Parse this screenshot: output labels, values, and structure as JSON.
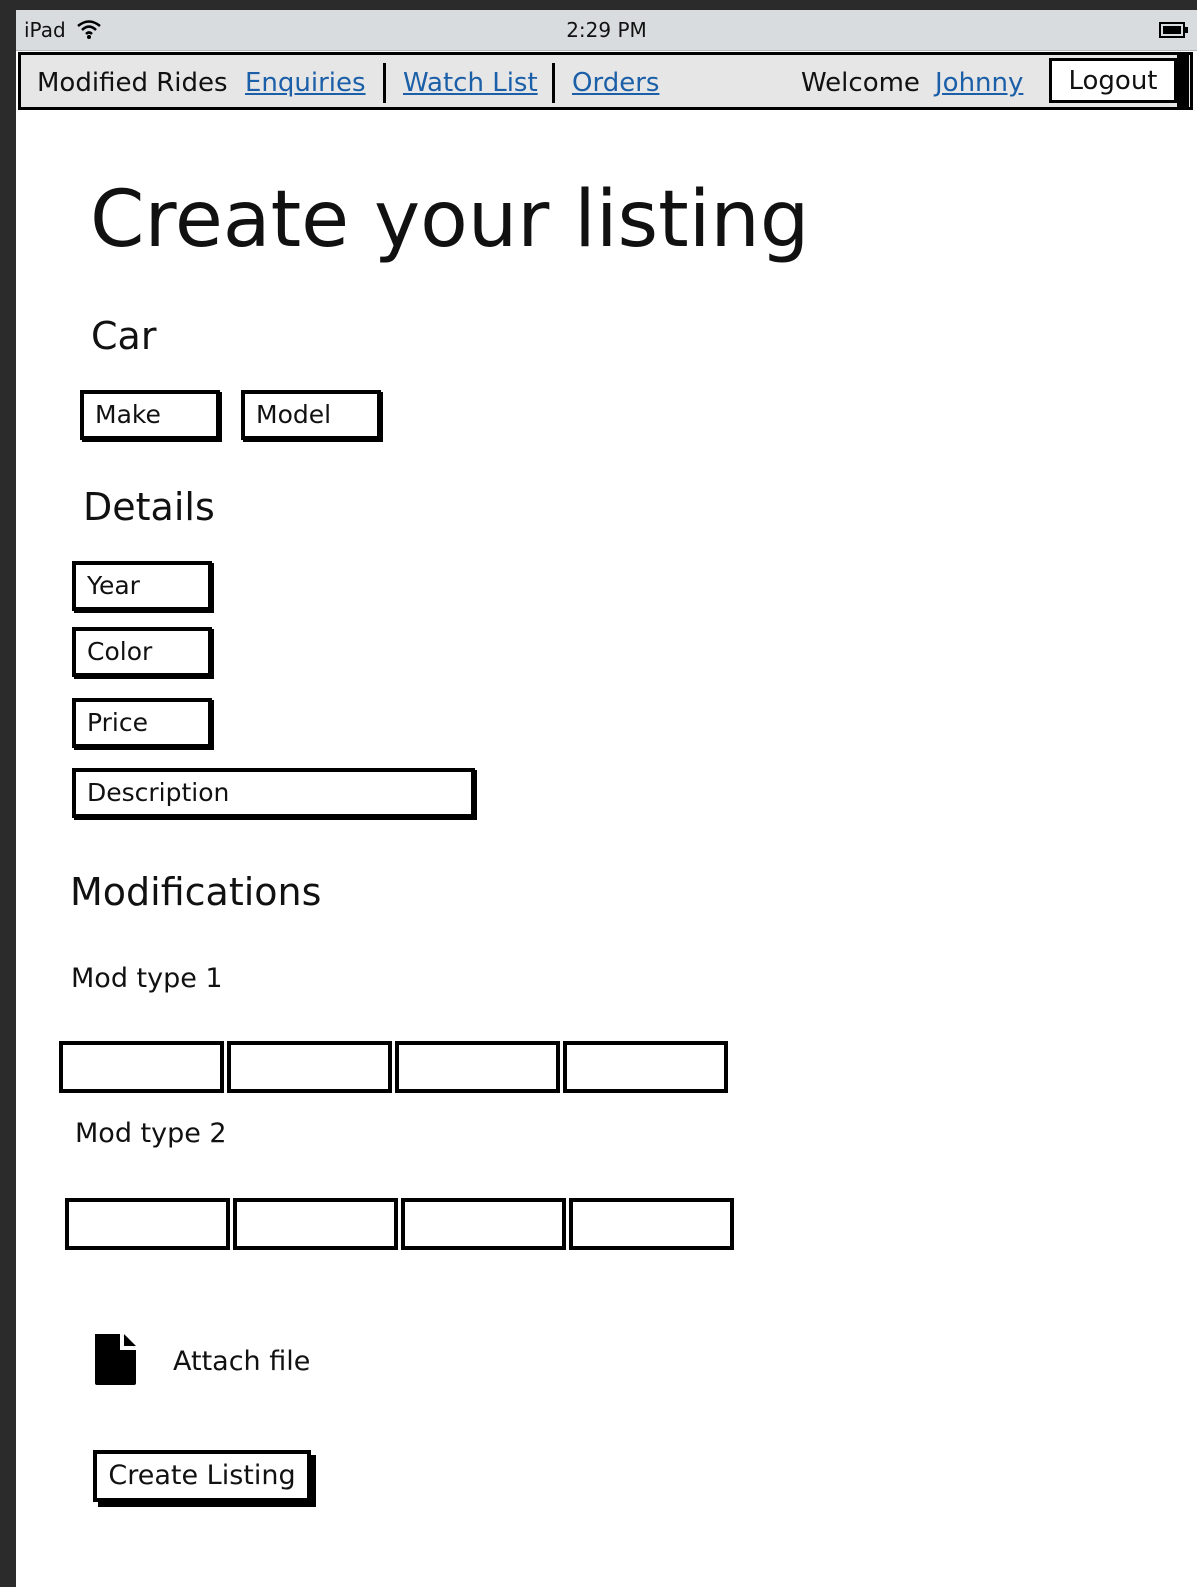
{
  "status_bar": {
    "carrier": "iPad",
    "time": "2:29 PM"
  },
  "nav": {
    "brand": "Modified Rides",
    "links": [
      "Enquiries",
      "Watch List",
      "Orders"
    ],
    "welcome": "Welcome",
    "user": "Johnny",
    "logout": "Logout"
  },
  "page": {
    "title": "Create your listing"
  },
  "car": {
    "heading": "Car",
    "make_placeholder": "Make",
    "model_placeholder": "Model"
  },
  "details": {
    "heading": "Details",
    "year_placeholder": "Year",
    "color_placeholder": "Color",
    "price_placeholder": "Price",
    "description_placeholder": "Description"
  },
  "modifications": {
    "heading": "Modifications",
    "type1_label": "Mod type 1",
    "type2_label": "Mod type 2"
  },
  "attach": {
    "label": "Attach file"
  },
  "submit": {
    "label": "Create Listing"
  }
}
